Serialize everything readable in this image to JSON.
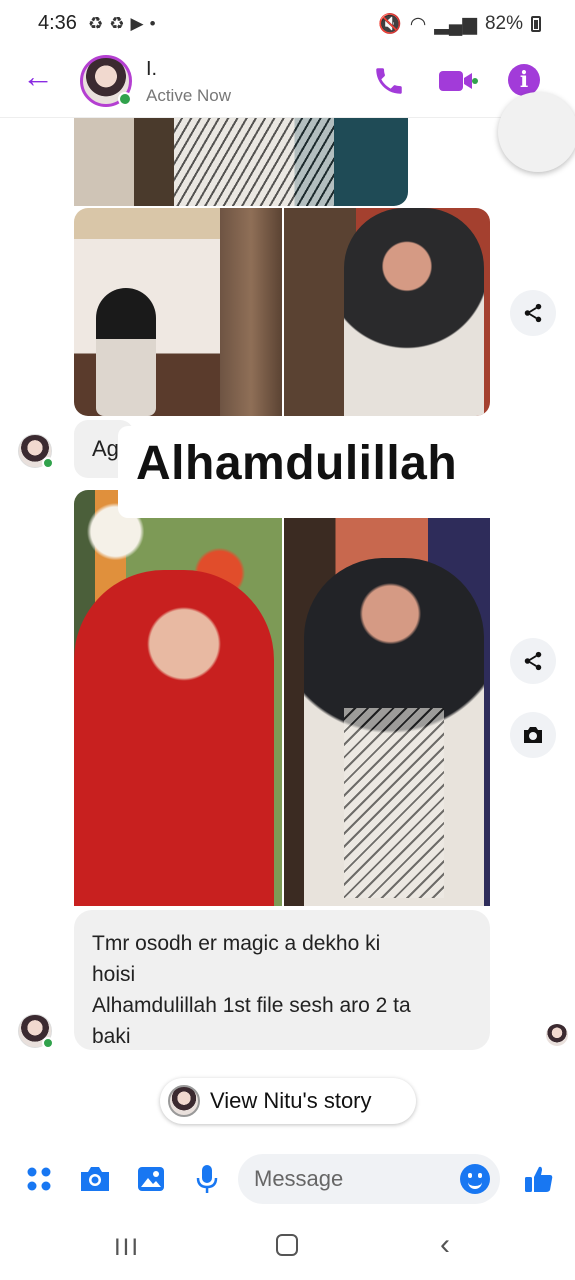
{
  "status_bar": {
    "time": "4:36",
    "battery": "82%"
  },
  "header": {
    "contact_name": "I.",
    "status": "Active Now",
    "icons": [
      "back-arrow-icon",
      "phone-icon",
      "video-icon",
      "info-icon"
    ],
    "accent_color": "#a23bd9"
  },
  "conversation": {
    "caption_prefix": "Ag",
    "caption_overlay": "Alhamdulillah",
    "message_lines": [
      "Tmr osodh er magic a dekho ki",
      "hoisi",
      "Alhamdulillah 1st file sesh aro 2 ta",
      "baki"
    ]
  },
  "story": {
    "label": "View Nitu's story"
  },
  "composer": {
    "placeholder": "Message",
    "icons": [
      "apps-icon",
      "camera-icon",
      "gallery-icon",
      "mic-icon",
      "emoji-icon",
      "thumbs-up-icon"
    ],
    "accent_color": "#1877f2"
  },
  "nav": {
    "recent_label": "III"
  }
}
